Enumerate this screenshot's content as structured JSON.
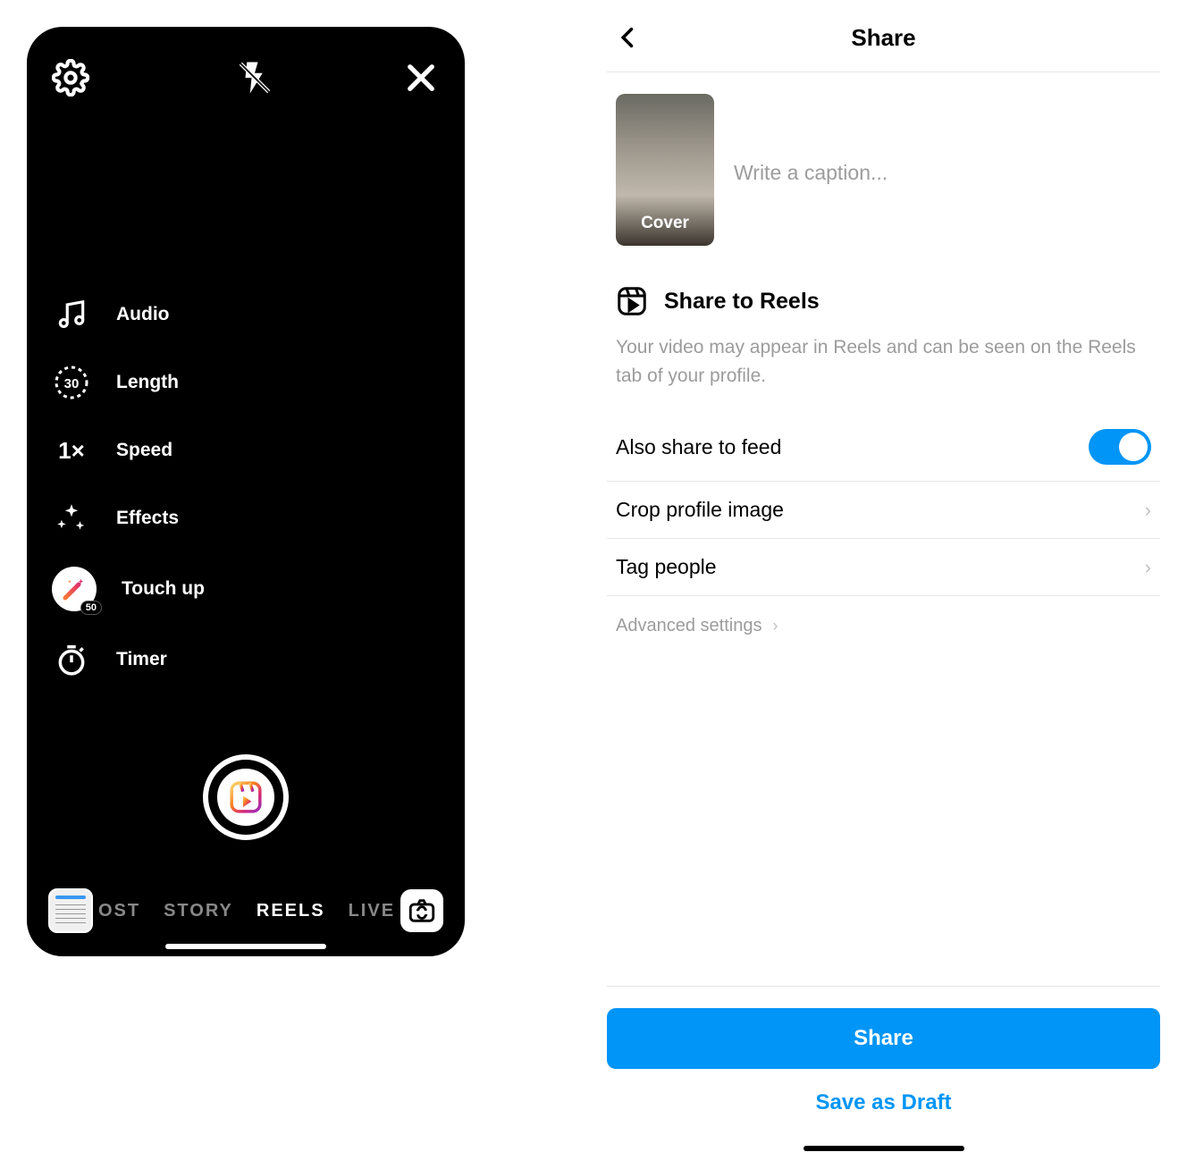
{
  "camera": {
    "tools": {
      "audio": "Audio",
      "length": "Length",
      "length_value": "30",
      "speed": "Speed",
      "speed_value": "1×",
      "effects": "Effects",
      "touchup": "Touch up",
      "touchup_badge": "50",
      "timer": "Timer"
    },
    "modes": {
      "post": "OST",
      "story": "STORY",
      "reels": "REELS",
      "live": "LIVE"
    }
  },
  "share": {
    "title": "Share",
    "caption_placeholder": "Write a caption...",
    "cover_label": "Cover",
    "share_to_reels_title": "Share to Reels",
    "share_to_reels_desc": "Your video may appear in Reels and can be seen on the Reels tab of your profile.",
    "also_share_feed": "Also share to feed",
    "crop_profile": "Crop profile image",
    "tag_people": "Tag people",
    "advanced": "Advanced settings",
    "share_button": "Share",
    "draft_button": "Save as Draft",
    "also_share_feed_on": true
  }
}
